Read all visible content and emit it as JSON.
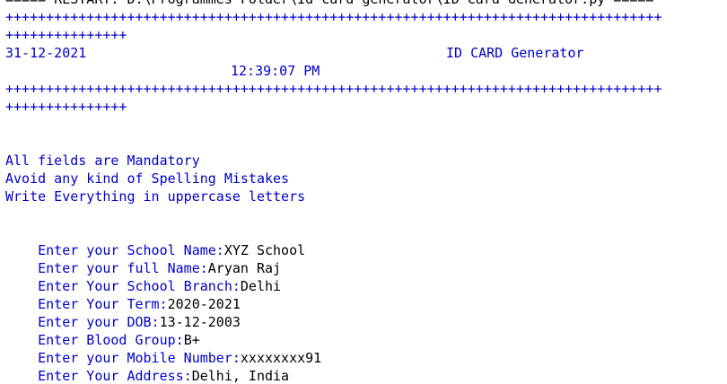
{
  "restart_line": "===== RESTART: D:\\Programmes Folder\\Id card generator\\ID Card Generator.py =====",
  "banner": {
    "plus_line_1": "+++++++++++++++++++++++++++++++++++++++++++++++++++++++++++++++++++++++++++++++++",
    "plus_line_2": "+++++++++++++++",
    "date": "31-12-2021",
    "title": "ID CARD Generator",
    "time": "12:39:07 PM",
    "plus_line_3": "+++++++++++++++++++++++++++++++++++++++++++++++++++++++++++++++++++++++++++++++++",
    "plus_line_4": "+++++++++++++++"
  },
  "instructions": [
    "All fields are Mandatory",
    "Avoid any kind of Spelling Mistakes",
    "Write Everything in uppercase letters"
  ],
  "fields": [
    {
      "prompt": "Enter your School Name:",
      "value": "XYZ School"
    },
    {
      "prompt": "Enter your full Name:",
      "value": "Aryan Raj"
    },
    {
      "prompt": "Enter Your School Branch:",
      "value": "Delhi"
    },
    {
      "prompt": "Enter Your Term:",
      "value": "2020-2021"
    },
    {
      "prompt": "Enter your DOB:",
      "value": "13-12-2003"
    },
    {
      "prompt": "Enter Blood Group:",
      "value": "B+"
    },
    {
      "prompt": "Enter your Mobile Number:",
      "value": "xxxxxxxx91"
    },
    {
      "prompt": "Enter Your Address:",
      "value": "Delhi, India"
    }
  ],
  "shell_prompt": ">>>",
  "colors": {
    "output": "#0000c8",
    "input": "#000000",
    "prompt": "#c80000"
  }
}
